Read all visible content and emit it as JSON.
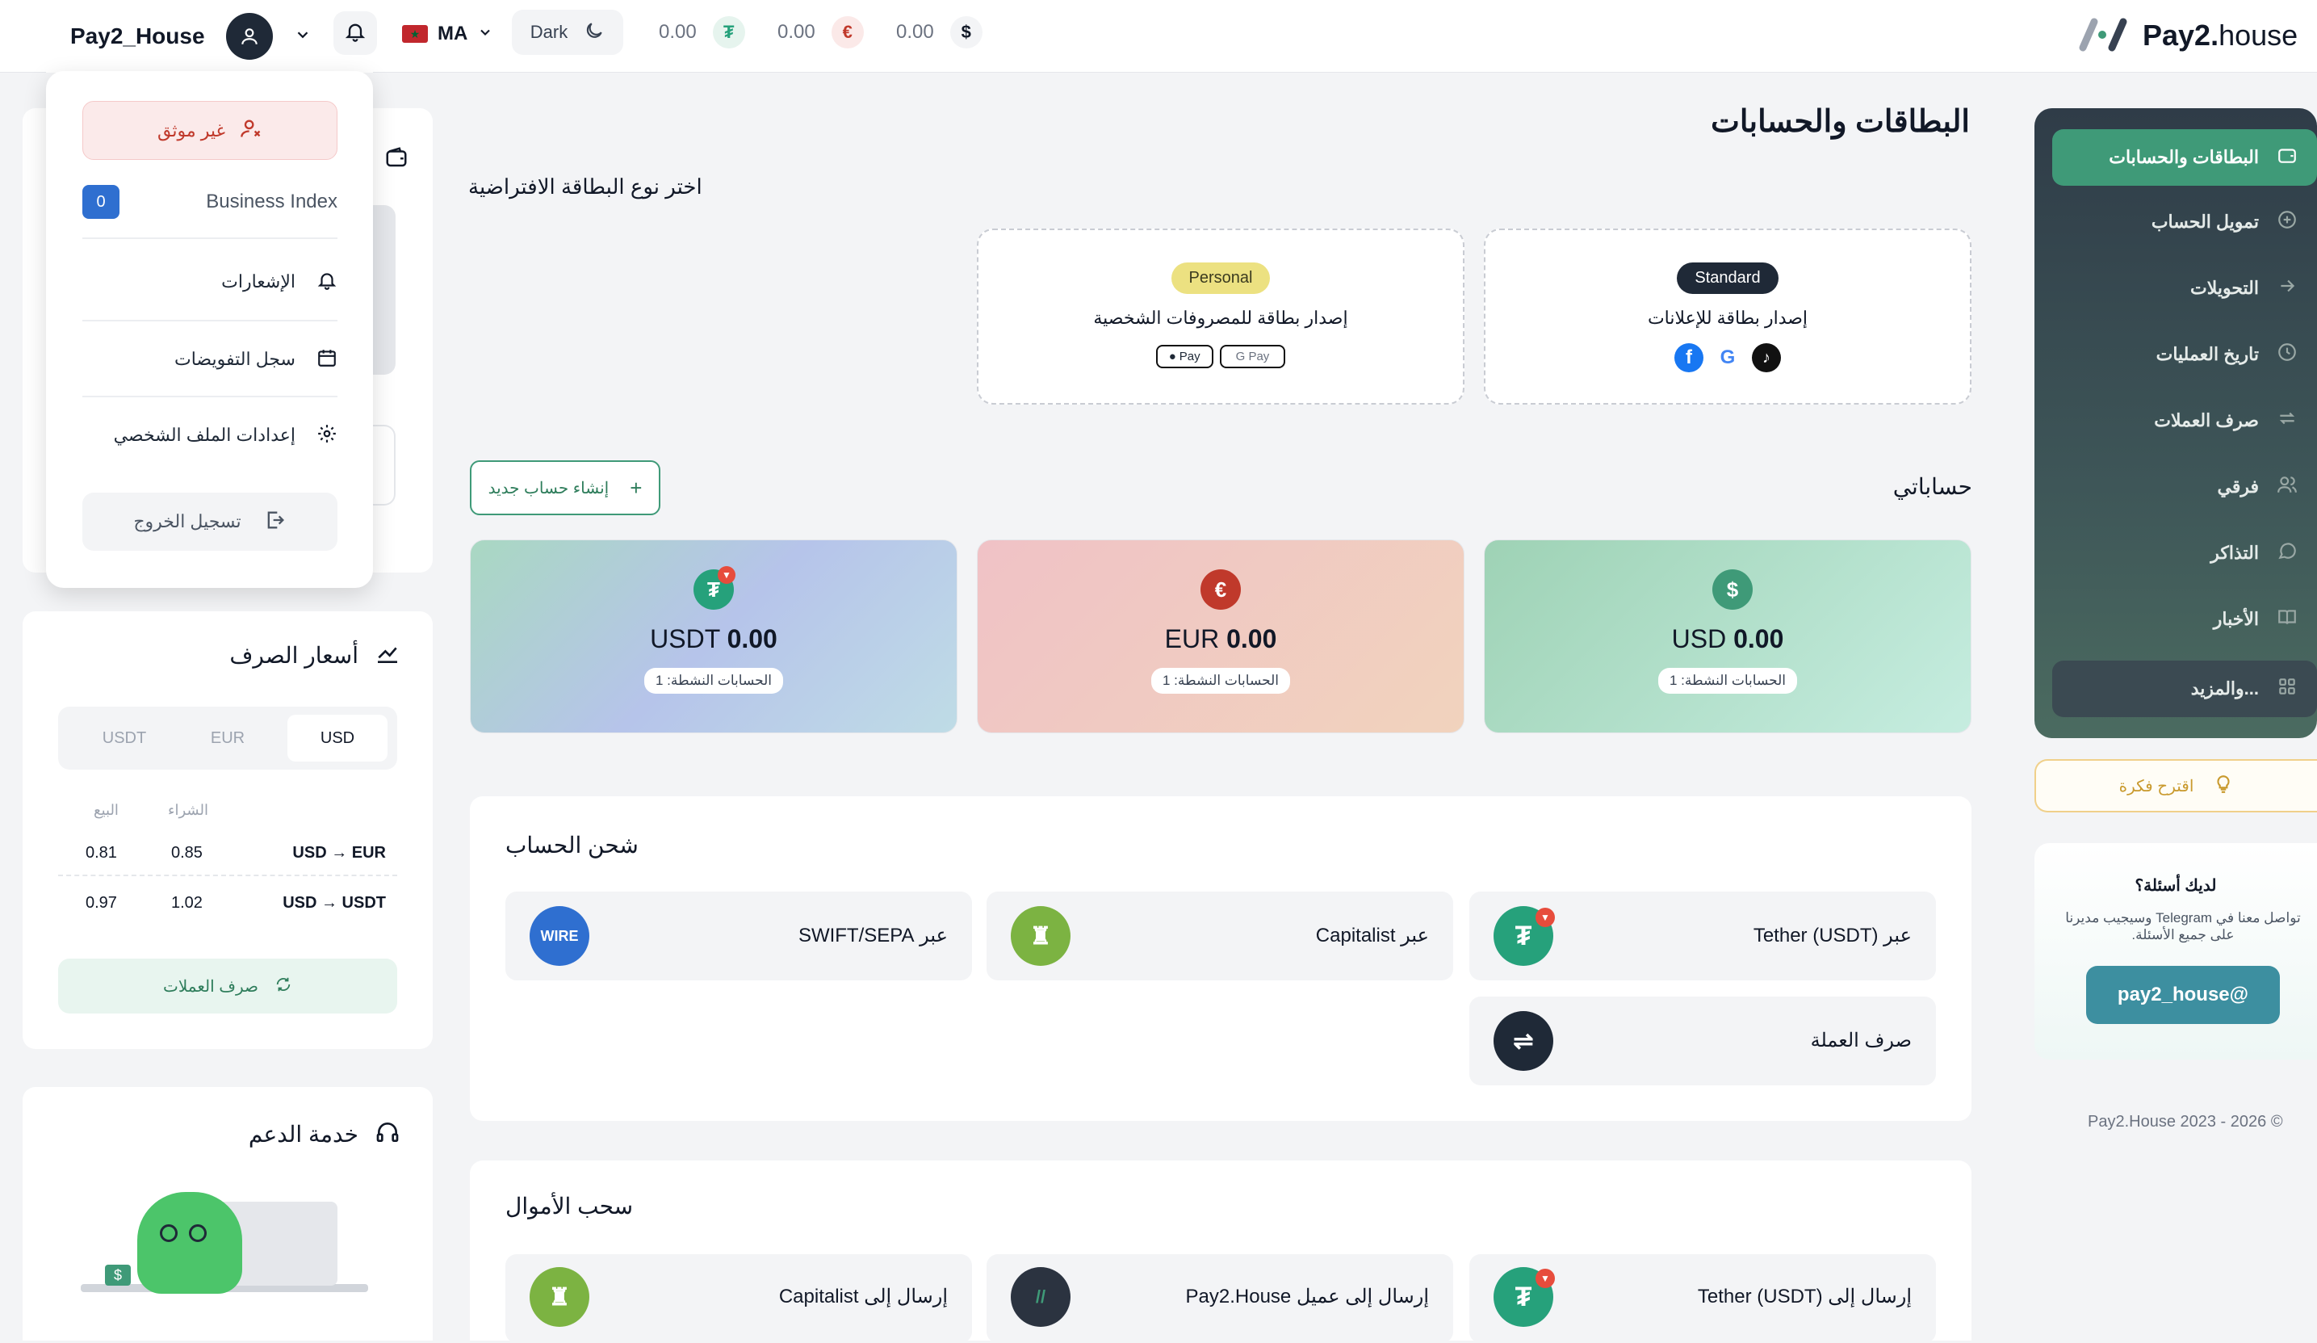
{
  "topbar": {
    "username": "Pay2_House",
    "lang": "MA",
    "theme_label": "Dark",
    "balances": [
      {
        "amount": "0.00",
        "icon": "tether-icon",
        "symbol": "₮",
        "color": "#26a17b"
      },
      {
        "amount": "0.00",
        "icon": "euro-icon",
        "symbol": "€",
        "color": "#c0392b"
      },
      {
        "amount": "0.00",
        "icon": "dollar-icon",
        "symbol": "$",
        "color": "#111827"
      }
    ],
    "brand_bold": "Pay2.",
    "brand_thin": "house"
  },
  "user_menu": {
    "status": "غير موثق",
    "business_index_label": "Business Index",
    "business_index_value": "0",
    "items": [
      "الإشعارات",
      "سجل التفويضات",
      "إعدادات الملف الشخصي"
    ],
    "logout": "تسجيل الخروج"
  },
  "sidebar": {
    "items": [
      {
        "label": "البطاقات والحسابات",
        "icon": "wallet-icon"
      },
      {
        "label": "تمويل الحساب",
        "icon": "plus-circle-icon"
      },
      {
        "label": "التحويلات",
        "icon": "arrow-right-icon"
      },
      {
        "label": "تاريخ العمليات",
        "icon": "clock-icon"
      },
      {
        "label": "صرف العملات",
        "icon": "exchange-icon"
      },
      {
        "label": "فرقي",
        "icon": "users-icon"
      },
      {
        "label": "التذاكر",
        "icon": "chat-icon"
      },
      {
        "label": "الأخبار",
        "icon": "book-icon"
      },
      {
        "label": "والمزيد...",
        "icon": "grid-icon"
      }
    ],
    "idea_button": "اقترح فكرة",
    "questions_title": "لديك أسئلة؟",
    "questions_text": "تواصل معنا في Telegram وسيجيب مديرنا على جميع الأسئلة.",
    "telegram_button": "pay2_house@",
    "copyright": "Pay2.House 2023 - 2026 ©"
  },
  "main": {
    "title": "البطاقات والحسابات",
    "card_type_title": "اختر نوع البطاقة الافتراضية",
    "card_types": [
      {
        "badge": "Standard",
        "desc": "إصدار بطاقة للإعلانات"
      },
      {
        "badge": "Personal",
        "desc": "إصدار بطاقة للمصروفات الشخصية",
        "pay1": "Pay",
        "pay2": "G Pay"
      }
    ],
    "accounts_title": "حساباتي",
    "new_account_button": "إنشاء حساب جديد",
    "accounts": [
      {
        "currency": "USD",
        "amount": "0.00",
        "active": "الحسابات النشطة: 1",
        "symbol": "$"
      },
      {
        "currency": "EUR",
        "amount": "0.00",
        "active": "الحسابات النشطة: 1",
        "symbol": "€"
      },
      {
        "currency": "USDT",
        "amount": "0.00",
        "active": "الحسابات النشطة: 1",
        "symbol": "₮"
      }
    ],
    "topup_title": "شحن الحساب",
    "topup_options": [
      "عبر Tether (USDT)",
      "عبر Capitalist",
      "عبر SWIFT/SEPA",
      "صرف العملة"
    ],
    "withdraw_title": "سحب الأموال",
    "withdraw_options": [
      "إرسال إلى Tether (USDT)",
      "إرسال إلى عميل Pay2.House",
      "إرسال إلى Capitalist"
    ],
    "wire_text": "WIRE"
  },
  "rates": {
    "title": "أسعار الصرف",
    "tabs": [
      "USD",
      "EUR",
      "USDT"
    ],
    "col_buy": "الشراء",
    "col_sell": "البيع",
    "rows": [
      {
        "pair": "USD → EUR",
        "buy": "0.85",
        "sell": "0.81"
      },
      {
        "pair": "USD → USDT",
        "buy": "1.02",
        "sell": "0.97"
      }
    ],
    "exchange_button": "صرف العملات"
  },
  "support": {
    "title": "خدمة الدعم"
  }
}
